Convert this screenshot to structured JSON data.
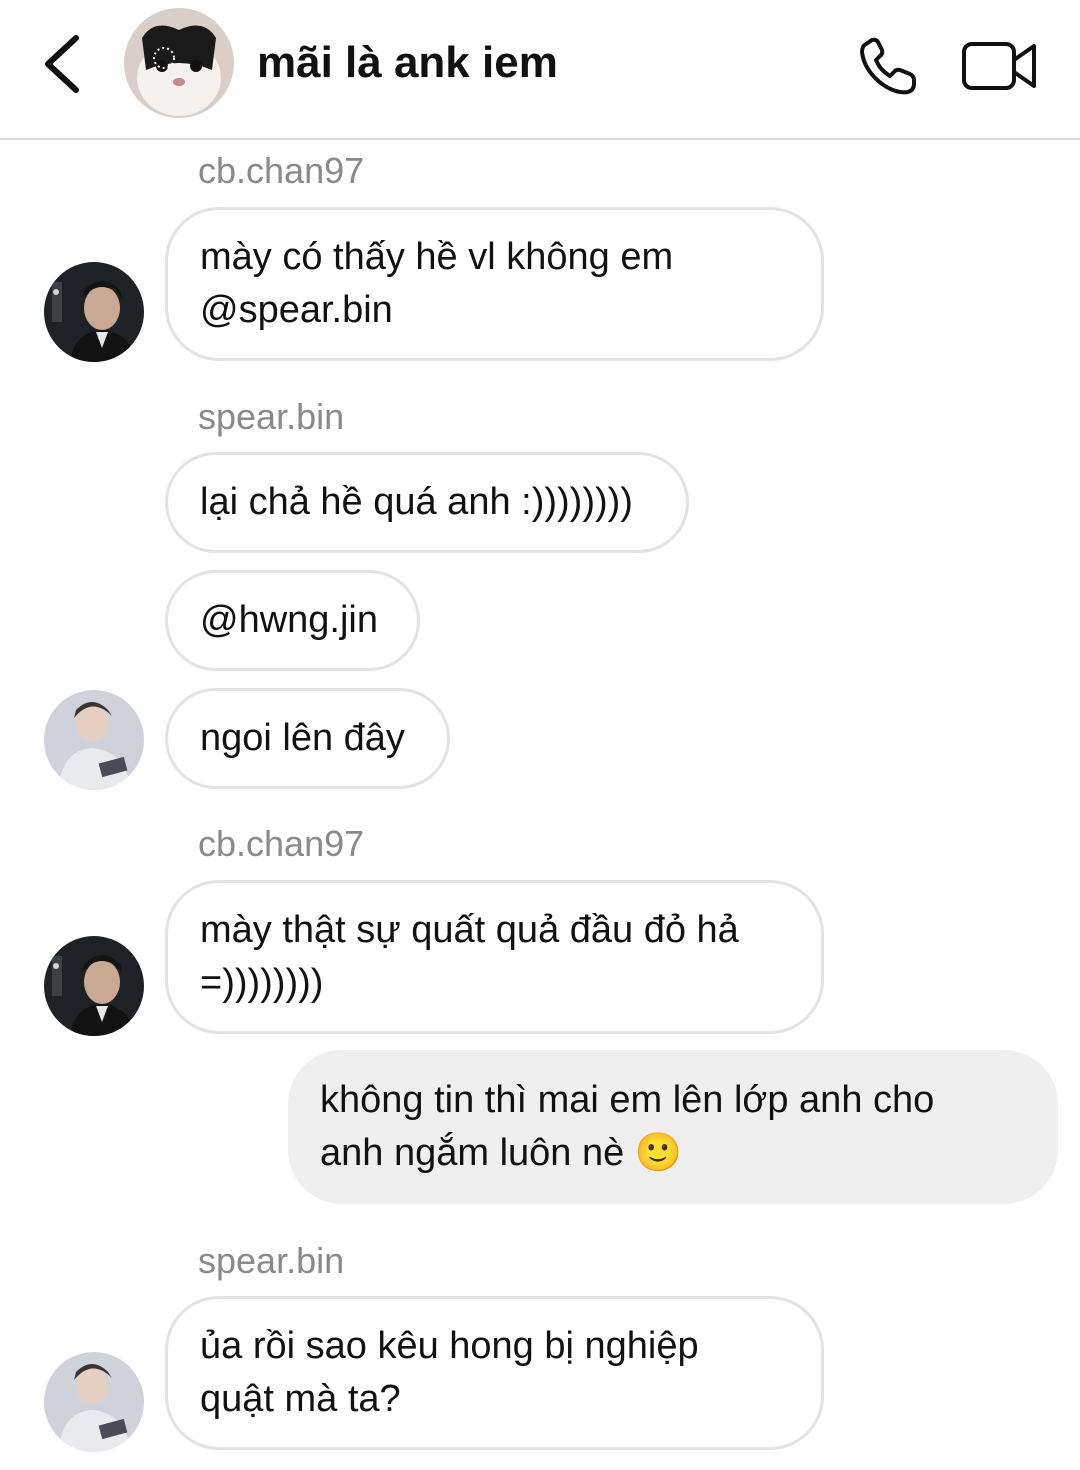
{
  "header": {
    "title": "mãi là ank iem",
    "back_icon": "chevron-left-icon",
    "call_icon": "phone-icon",
    "video_icon": "video-camera-icon"
  },
  "messages": [
    {
      "sender": "cb.chan97",
      "text": "mày có thấy hề vl không em\n@spear.bin"
    },
    {
      "sender": "spear.bin",
      "text": "lại chả hề quá anh :))))))))"
    },
    {
      "text": "@hwng.jin"
    },
    {
      "text": "ngoi lên đây"
    },
    {
      "sender": "cb.chan97",
      "text": "mày thật sự quất quả đầu đỏ hả\n=))))))))"
    },
    {
      "text": "không tin thì mai em lên lớp anh cho\nanh ngắm luôn nè 🙂",
      "outgoing": true
    },
    {
      "sender": "spear.bin",
      "text": "ủa rồi sao kêu hong bị nghiệp\nquật mà ta?"
    }
  ],
  "colors": {
    "bubble_border": "#e3e3e3",
    "outgoing_bubble": "#efefef",
    "sender_label": "#8a8a8a"
  }
}
